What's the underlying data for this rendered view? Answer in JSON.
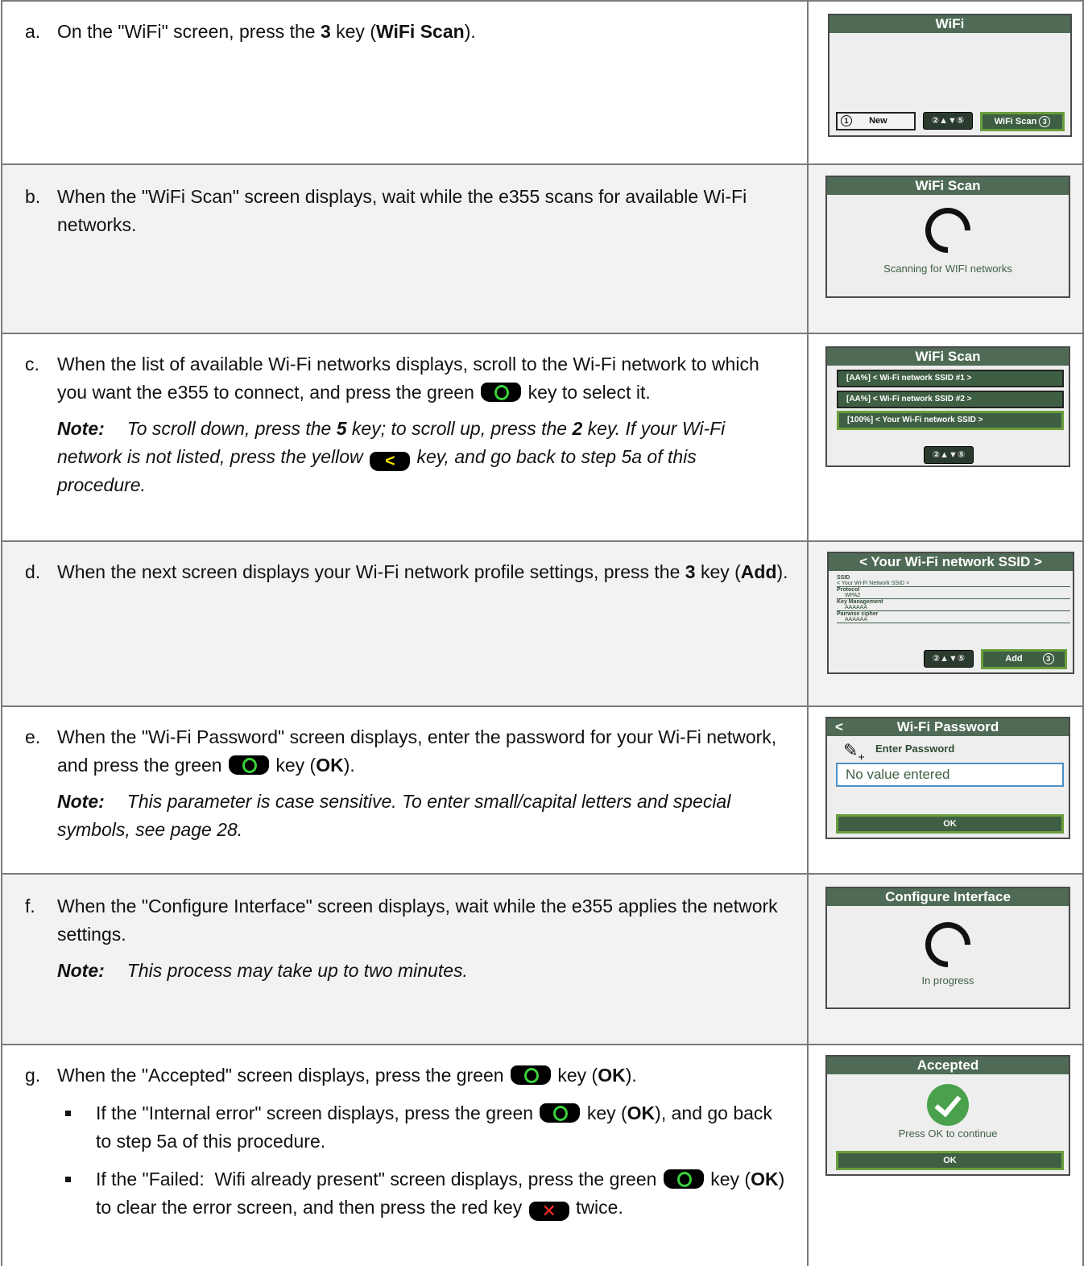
{
  "steps": [
    {
      "letter": "a.",
      "text_html": "On the \"WiFi\" screen, press the <b>3</b> key (<b>WiFi Scan</b>)."
    },
    {
      "letter": "b.",
      "text_html": "When the \"WiFi Scan\" screen displays, wait while the e355 scans for available Wi-Fi networks."
    },
    {
      "letter": "c.",
      "text_html": "When the list of available Wi-Fi networks displays, scroll to the Wi-Fi network to which you want the e355 to connect, and press the green <span class=\"key green\" data-name=\"green-key-icon\" data-interactable=\"false\"></span> key to select it.",
      "note_label": "Note:",
      "note_html": "To scroll down, press the <b>5</b> key; to scroll up, press the <b>2</b> key. If your Wi-Fi network is not listed, press the yellow <span class=\"key yellow\" data-name=\"yellow-key-icon\" data-interactable=\"false\">&lt;</span> key, and go back to step 5a of this procedure."
    },
    {
      "letter": "d.",
      "text_html": "When the next screen displays your Wi-Fi network profile settings, press the <b>3</b> key (<b>Add</b>)."
    },
    {
      "letter": "e.",
      "text_html": "When the \"Wi-Fi Password\" screen displays, enter the password for your Wi-Fi network, and press the green <span class=\"key green\" data-name=\"green-key-icon\" data-interactable=\"false\"></span> key (<b>OK</b>).",
      "note_label": "Note:",
      "note_html": "This parameter is case sensitive. To enter small/capital letters and special symbols, see page 28."
    },
    {
      "letter": "f.",
      "text_html": "When the \"Configure Interface\" screen displays, wait while the e355 applies the network settings.",
      "note_label": "Note:",
      "note_html": "This process may take up to two minutes."
    },
    {
      "letter": "g.",
      "text_html": "When the \"Accepted\" screen displays, press the green <span class=\"key green\" data-name=\"green-key-icon\" data-interactable=\"false\"></span> key (<b>OK</b>).",
      "bullets_html": [
        "If the \"Internal error\" screen displays, press the green <span class=\"key green\" data-name=\"green-key-icon\" data-interactable=\"false\"></span> key (<b>OK</b>), and go back to step 5a of this procedure.",
        "If the \"Failed: &nbsp;Wifi already present\" screen displays, press the green <span class=\"key green\" data-name=\"green-key-icon\" data-interactable=\"false\"></span> key (<b>OK</b>) to clear the error screen, and then press the red key <span class=\"key red\" data-name=\"red-key-icon\" data-interactable=\"false\">✕</span> twice."
      ]
    }
  ],
  "screens": {
    "wifi": {
      "title": "WiFi",
      "btn_new": "New",
      "btn_scan": "WiFi Scan",
      "arrows": "▲▼"
    },
    "scan": {
      "title": "WiFi Scan",
      "status": "Scanning for WIFI networks"
    },
    "list": {
      "title": "WiFi Scan",
      "items": [
        "[AA%]  < Wi-Fi network SSID #1 >",
        "[AA%]  < Wi-Fi network SSID #2 >",
        "[100%]  < Your Wi-Fi network SSID >"
      ]
    },
    "profile": {
      "title": "< Your Wi-Fi network SSID >",
      "fields": [
        {
          "k": "SSID",
          "v": "< Your Wi-Fi Network SSID >"
        },
        {
          "k": "Protocol",
          "v": "WPA2"
        },
        {
          "k": "Key Management",
          "v": "AAAAAA"
        },
        {
          "k": "Pairwise cipher",
          "v": "AAAAAA"
        }
      ],
      "btn_add": "Add"
    },
    "password": {
      "back": "<",
      "title": "Wi-Fi Password",
      "label": "Enter Password",
      "placeholder": "No value entered",
      "btn_ok": "OK"
    },
    "configure": {
      "title": "Configure Interface",
      "status": "In progress"
    },
    "accepted": {
      "title": "Accepted",
      "status": "Press OK to continue",
      "btn_ok": "OK"
    }
  }
}
